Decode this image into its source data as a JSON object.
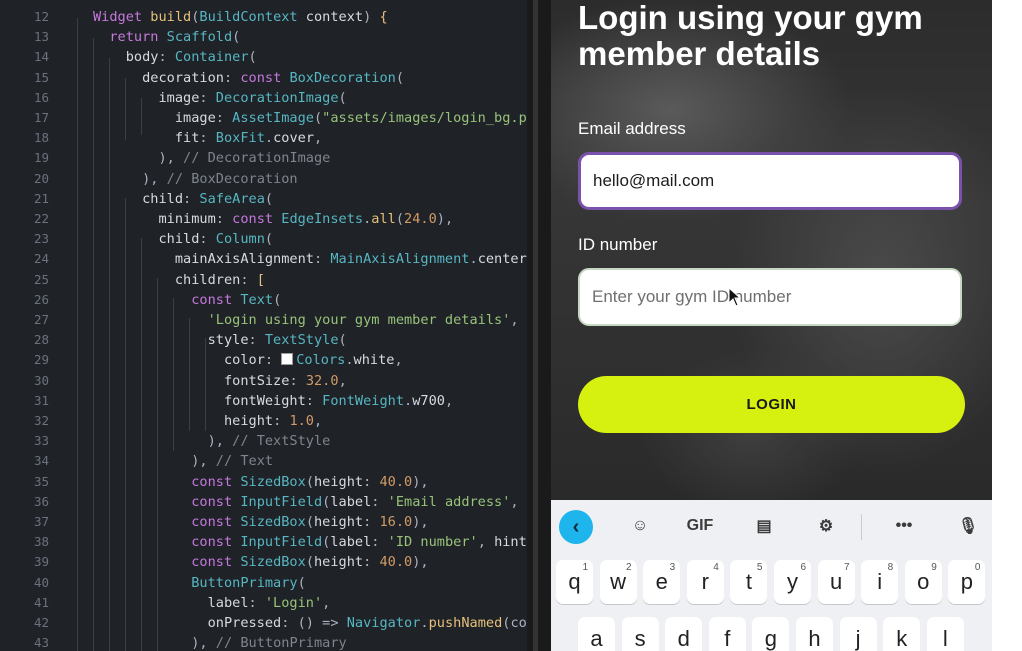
{
  "editor": {
    "lines": [
      {
        "n": "12",
        "tokens": [
          [
            "kw",
            "Widget"
          ],
          [
            "pu",
            " "
          ],
          [
            "fn",
            "build"
          ],
          [
            "pu",
            "("
          ],
          [
            "ty",
            "BuildContext"
          ],
          [
            "pr",
            " context"
          ],
          [
            "pu",
            ") "
          ],
          [
            "br",
            "{"
          ]
        ]
      },
      {
        "n": "13",
        "tokens": [
          [
            "pu",
            "  "
          ],
          [
            "kw",
            "return"
          ],
          [
            "pu",
            " "
          ],
          [
            "ty",
            "Scaffold"
          ],
          [
            "pu",
            "("
          ]
        ]
      },
      {
        "n": "14",
        "tokens": [
          [
            "pu",
            "    "
          ],
          [
            "pr",
            "body"
          ],
          [
            "pu",
            ": "
          ],
          [
            "ty",
            "Container"
          ],
          [
            "pu",
            "("
          ]
        ]
      },
      {
        "n": "15",
        "tokens": [
          [
            "pu",
            "      "
          ],
          [
            "pr",
            "decoration"
          ],
          [
            "pu",
            ": "
          ],
          [
            "kw",
            "const"
          ],
          [
            "pu",
            " "
          ],
          [
            "ty",
            "BoxDecoration"
          ],
          [
            "pu",
            "("
          ]
        ]
      },
      {
        "n": "16",
        "tokens": [
          [
            "pu",
            "        "
          ],
          [
            "pr",
            "image"
          ],
          [
            "pu",
            ": "
          ],
          [
            "ty",
            "DecorationImage"
          ],
          [
            "pu",
            "("
          ]
        ]
      },
      {
        "n": "17",
        "tokens": [
          [
            "pu",
            "          "
          ],
          [
            "pr",
            "image"
          ],
          [
            "pu",
            ": "
          ],
          [
            "ty",
            "AssetImage"
          ],
          [
            "pu",
            "("
          ],
          [
            "st",
            "\"assets/images/login_bg.p"
          ]
        ]
      },
      {
        "n": "18",
        "tokens": [
          [
            "pu",
            "          "
          ],
          [
            "pr",
            "fit"
          ],
          [
            "pu",
            ": "
          ],
          [
            "ty",
            "BoxFit"
          ],
          [
            "pu",
            "."
          ],
          [
            "pr",
            "cover"
          ],
          [
            "pu",
            ","
          ]
        ]
      },
      {
        "n": "19",
        "tokens": [
          [
            "pu",
            "        "
          ],
          [
            "pu",
            "), "
          ],
          [
            "cm",
            "// DecorationImage"
          ]
        ]
      },
      {
        "n": "20",
        "tokens": [
          [
            "pu",
            "      "
          ],
          [
            "pu",
            "), "
          ],
          [
            "cm",
            "// BoxDecoration"
          ]
        ]
      },
      {
        "n": "21",
        "tokens": [
          [
            "pu",
            "      "
          ],
          [
            "pr",
            "child"
          ],
          [
            "pu",
            ": "
          ],
          [
            "ty",
            "SafeArea"
          ],
          [
            "pu",
            "("
          ]
        ]
      },
      {
        "n": "22",
        "tokens": [
          [
            "pu",
            "        "
          ],
          [
            "pr",
            "minimum"
          ],
          [
            "pu",
            ": "
          ],
          [
            "kw",
            "const"
          ],
          [
            "pu",
            " "
          ],
          [
            "ty",
            "EdgeInsets"
          ],
          [
            "pu",
            "."
          ],
          [
            "fn",
            "all"
          ],
          [
            "pu",
            "("
          ],
          [
            "nu",
            "24.0"
          ],
          [
            "pu",
            "),"
          ]
        ]
      },
      {
        "n": "23",
        "tokens": [
          [
            "pu",
            "        "
          ],
          [
            "pr",
            "child"
          ],
          [
            "pu",
            ": "
          ],
          [
            "ty",
            "Column"
          ],
          [
            "pu",
            "("
          ]
        ]
      },
      {
        "n": "24",
        "tokens": [
          [
            "pu",
            "          "
          ],
          [
            "pr",
            "mainAxisAlignment"
          ],
          [
            "pu",
            ": "
          ],
          [
            "ty",
            "MainAxisAlignment"
          ],
          [
            "pu",
            "."
          ],
          [
            "pr",
            "center"
          ]
        ]
      },
      {
        "n": "25",
        "tokens": [
          [
            "pu",
            "          "
          ],
          [
            "pr",
            "children"
          ],
          [
            "pu",
            ": "
          ],
          [
            "br",
            "["
          ]
        ]
      },
      {
        "n": "26",
        "tokens": [
          [
            "pu",
            "            "
          ],
          [
            "kw",
            "const"
          ],
          [
            "pu",
            " "
          ],
          [
            "ty",
            "Text"
          ],
          [
            "pu",
            "("
          ]
        ]
      },
      {
        "n": "27",
        "tokens": [
          [
            "pu",
            "              "
          ],
          [
            "st",
            "'Login using your gym member details'"
          ],
          [
            "pu",
            ","
          ]
        ]
      },
      {
        "n": "28",
        "tokens": [
          [
            "pu",
            "              "
          ],
          [
            "pr",
            "style"
          ],
          [
            "pu",
            ": "
          ],
          [
            "ty",
            "TextStyle"
          ],
          [
            "pu",
            "("
          ]
        ]
      },
      {
        "n": "29",
        "tokens": [
          [
            "pu",
            "                "
          ],
          [
            "pr",
            "color"
          ],
          [
            "pu",
            ": "
          ],
          [
            "sw",
            ""
          ],
          [
            "ty",
            "Colors"
          ],
          [
            "pu",
            "."
          ],
          [
            "pr",
            "white"
          ],
          [
            "pu",
            ","
          ]
        ]
      },
      {
        "n": "30",
        "tokens": [
          [
            "pu",
            "                "
          ],
          [
            "pr",
            "fontSize"
          ],
          [
            "pu",
            ": "
          ],
          [
            "nu",
            "32.0"
          ],
          [
            "pu",
            ","
          ]
        ]
      },
      {
        "n": "31",
        "tokens": [
          [
            "pu",
            "                "
          ],
          [
            "pr",
            "fontWeight"
          ],
          [
            "pu",
            ": "
          ],
          [
            "ty",
            "FontWeight"
          ],
          [
            "pu",
            "."
          ],
          [
            "pr",
            "w700"
          ],
          [
            "pu",
            ","
          ]
        ]
      },
      {
        "n": "32",
        "tokens": [
          [
            "pu",
            "                "
          ],
          [
            "pr",
            "height"
          ],
          [
            "pu",
            ": "
          ],
          [
            "nu",
            "1.0"
          ],
          [
            "pu",
            ","
          ]
        ]
      },
      {
        "n": "33",
        "tokens": [
          [
            "pu",
            "              "
          ],
          [
            "pu",
            "), "
          ],
          [
            "cm",
            "// TextStyle"
          ]
        ]
      },
      {
        "n": "34",
        "tokens": [
          [
            "pu",
            "            "
          ],
          [
            "pu",
            "), "
          ],
          [
            "cm",
            "// Text"
          ]
        ]
      },
      {
        "n": "35",
        "tokens": [
          [
            "pu",
            "            "
          ],
          [
            "kw",
            "const"
          ],
          [
            "pu",
            " "
          ],
          [
            "ty",
            "SizedBox"
          ],
          [
            "pu",
            "("
          ],
          [
            "pr",
            "height"
          ],
          [
            "pu",
            ": "
          ],
          [
            "nu",
            "40.0"
          ],
          [
            "pu",
            "),"
          ]
        ]
      },
      {
        "n": "36",
        "tokens": [
          [
            "pu",
            "            "
          ],
          [
            "kw",
            "const"
          ],
          [
            "pu",
            " "
          ],
          [
            "ty",
            "InputField"
          ],
          [
            "pu",
            "("
          ],
          [
            "pr",
            "label"
          ],
          [
            "pu",
            ": "
          ],
          [
            "st",
            "'Email address'"
          ],
          [
            "pu",
            ","
          ]
        ]
      },
      {
        "n": "37",
        "tokens": [
          [
            "pu",
            "            "
          ],
          [
            "kw",
            "const"
          ],
          [
            "pu",
            " "
          ],
          [
            "ty",
            "SizedBox"
          ],
          [
            "pu",
            "("
          ],
          [
            "pr",
            "height"
          ],
          [
            "pu",
            ": "
          ],
          [
            "nu",
            "16.0"
          ],
          [
            "pu",
            "),"
          ]
        ]
      },
      {
        "n": "38",
        "tokens": [
          [
            "pu",
            "            "
          ],
          [
            "kw",
            "const"
          ],
          [
            "pu",
            " "
          ],
          [
            "ty",
            "InputField"
          ],
          [
            "pu",
            "("
          ],
          [
            "pr",
            "label"
          ],
          [
            "pu",
            ": "
          ],
          [
            "st",
            "'ID number'"
          ],
          [
            "pu",
            ", "
          ],
          [
            "pr",
            "hint"
          ]
        ]
      },
      {
        "n": "39",
        "tokens": [
          [
            "pu",
            "            "
          ],
          [
            "kw",
            "const"
          ],
          [
            "pu",
            " "
          ],
          [
            "ty",
            "SizedBox"
          ],
          [
            "pu",
            "("
          ],
          [
            "pr",
            "height"
          ],
          [
            "pu",
            ": "
          ],
          [
            "nu",
            "40.0"
          ],
          [
            "pu",
            "),"
          ]
        ]
      },
      {
        "n": "40",
        "tokens": [
          [
            "pu",
            "            "
          ],
          [
            "ty",
            "ButtonPrimary"
          ],
          [
            "pu",
            "("
          ]
        ]
      },
      {
        "n": "41",
        "tokens": [
          [
            "pu",
            "              "
          ],
          [
            "pr",
            "label"
          ],
          [
            "pu",
            ": "
          ],
          [
            "st",
            "'Login'"
          ],
          [
            "pu",
            ","
          ]
        ]
      },
      {
        "n": "42",
        "tokens": [
          [
            "pu",
            "              "
          ],
          [
            "pr",
            "onPressed"
          ],
          [
            "pu",
            ": () => "
          ],
          [
            "ty",
            "Navigator"
          ],
          [
            "pu",
            "."
          ],
          [
            "fn",
            "pushNamed"
          ],
          [
            "pu",
            "(co"
          ]
        ]
      },
      {
        "n": "43",
        "tokens": [
          [
            "pu",
            "            "
          ],
          [
            "pu",
            "), "
          ],
          [
            "cm",
            "// ButtonPrimary"
          ]
        ]
      }
    ]
  },
  "app": {
    "title": "Login using your gym member details",
    "email_label": "Email address",
    "email_value": "hello@mail.com",
    "id_label": "ID number",
    "id_placeholder": "Enter your gym ID number",
    "login_label": "LOGIN"
  },
  "keyboard": {
    "toolbar": [
      {
        "name": "back-icon",
        "glyph": "‹"
      },
      {
        "name": "sticker-icon",
        "glyph": "☺"
      },
      {
        "name": "gif-button",
        "glyph": "GIF"
      },
      {
        "name": "clipboard-icon",
        "glyph": "▤"
      },
      {
        "name": "settings-icon",
        "glyph": "⚙"
      },
      {
        "name": "more-icon",
        "glyph": "•••"
      },
      {
        "name": "microphone-icon",
        "glyph": "🎙"
      }
    ],
    "row1": [
      {
        "k": "q",
        "h": "1"
      },
      {
        "k": "w",
        "h": "2"
      },
      {
        "k": "e",
        "h": "3"
      },
      {
        "k": "r",
        "h": "4"
      },
      {
        "k": "t",
        "h": "5"
      },
      {
        "k": "y",
        "h": "6"
      },
      {
        "k": "u",
        "h": "7"
      },
      {
        "k": "i",
        "h": "8"
      },
      {
        "k": "o",
        "h": "9"
      },
      {
        "k": "p",
        "h": "0"
      }
    ],
    "row2": [
      "a",
      "s",
      "d",
      "f",
      "g",
      "h",
      "j",
      "k",
      "l"
    ]
  },
  "colors": {
    "accent": "#d6f00f",
    "focus_border": "#7b52ab",
    "keyboard_back": "#1eb4ec"
  }
}
